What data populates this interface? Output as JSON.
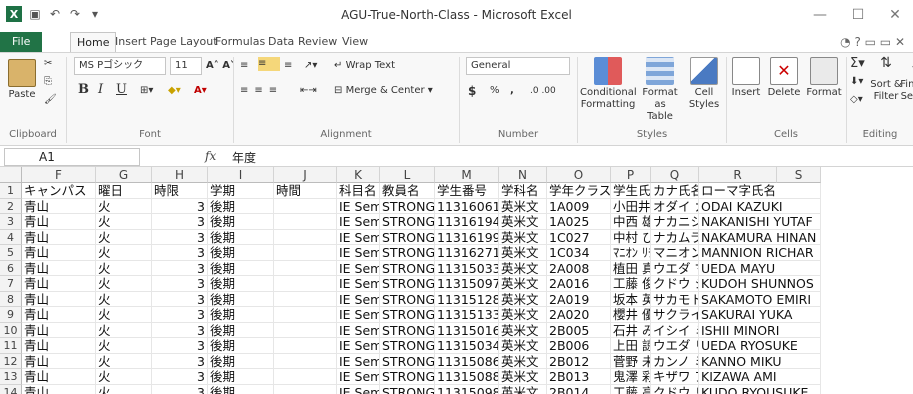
{
  "window": {
    "title": "AGU-True-North-Class - Microsoft Excel",
    "app_icon": "X",
    "minimize": "—",
    "maximize": "☐",
    "close": "✕"
  },
  "tabs": [
    "File",
    "Home",
    "Insert",
    "Page Layout",
    "Formulas",
    "Data",
    "Review",
    "View"
  ],
  "ribbon": {
    "paste": "Paste",
    "font_name": "MS Pゴシック",
    "font_size": "11",
    "bold": "B",
    "italic": "I",
    "underline": "U",
    "wrap_text": "Wrap Text",
    "merge_center": "Merge & Center",
    "number_format": "General",
    "currency": "$",
    "percent": "%",
    "comma": ",",
    "inc_dec": ".0 .00",
    "conditional_formatting": [
      "Conditional",
      "Formatting"
    ],
    "format_as_table": [
      "Format as",
      "Table"
    ],
    "cell_styles": [
      "Cell",
      "Styles"
    ],
    "insert": "Insert",
    "delete": "Delete",
    "format": "Format",
    "sort_filter": [
      "Sort &",
      "Filter"
    ],
    "find_select": [
      "Find &",
      "Select"
    ],
    "groups": [
      "Clipboard",
      "Font",
      "Alignment",
      "Number",
      "Styles",
      "Cells",
      "Editing"
    ]
  },
  "formula_bar": {
    "name_box": "A1",
    "fx": "fx",
    "content": "年度"
  },
  "columns": [
    "F",
    "G",
    "H",
    "I",
    "J",
    "K",
    "L",
    "M",
    "N",
    "O",
    "P",
    "Q",
    "R",
    "S"
  ],
  "rows": [
    {
      "n": "1",
      "F": "キャンパス",
      "G": "曜日",
      "H": "時限",
      "I": "学期",
      "J": "時間",
      "K": "科目名",
      "L": "教員名",
      "M": "学生番号",
      "N": "学科名",
      "O": "学年クラス",
      "P": "学生氏名",
      "Q": "カナ氏名",
      "R": "ローマ字氏名"
    },
    {
      "n": "2",
      "F": "青山",
      "G": "火",
      "H": "3",
      "I": "後期",
      "K": "IE  Semir",
      "L": "STRONG",
      "M": "11316061",
      "N": "英米文",
      "O": "1A009",
      "P": "小田井  和",
      "Q": "オダイ  カ",
      "R": "ODAI KAZUKI"
    },
    {
      "n": "3",
      "F": "青山",
      "G": "火",
      "H": "3",
      "I": "後期",
      "K": "IE  Semir",
      "L": "STRONG",
      "M": "11316194",
      "N": "英米文",
      "O": "1A025",
      "P": "中西  雄太",
      "Q": "ナカニシ  ユ",
      "R": "NAKANISHI YUTAF"
    },
    {
      "n": "4",
      "F": "青山",
      "G": "火",
      "H": "3",
      "I": "後期",
      "K": "IE  Semir",
      "L": "STRONG",
      "M": "11316199",
      "N": "英米文",
      "O": "1C027",
      "P": "中村  ひな",
      "Q": "ナカムラ  ヒ",
      "R": "NAKAMURA HINAN"
    },
    {
      "n": "5",
      "F": "青山",
      "G": "火",
      "H": "3",
      "I": "後期",
      "K": "IE  Semir",
      "L": "STRONG",
      "M": "11316271",
      "N": "英米文",
      "O": "1C034",
      "P": "ﾏﾆｵﾝ ﾘﾁｬ",
      "Q": "マニオン  リ",
      "R": "MANNION RICHAR"
    },
    {
      "n": "6",
      "F": "青山",
      "G": "火",
      "H": "3",
      "I": "後期",
      "K": "IE  Semir",
      "L": "STRONG",
      "M": "11315033",
      "N": "英米文",
      "O": "2A008",
      "P": "植田  真由",
      "Q": "ウエダ  マ",
      "R": "UEDA MAYU"
    },
    {
      "n": "7",
      "F": "青山",
      "G": "火",
      "H": "3",
      "I": "後期",
      "K": "IE  Semir",
      "L": "STRONG",
      "M": "11315097",
      "N": "英米文",
      "O": "2A016",
      "P": "工藤  俊之",
      "Q": "クドウ  シュ",
      "R": "KUDOH SHUNNOS"
    },
    {
      "n": "8",
      "F": "青山",
      "G": "火",
      "H": "3",
      "I": "後期",
      "K": "IE  Semir",
      "L": "STRONG",
      "M": "11315128",
      "N": "英米文",
      "O": "2A019",
      "P": "坂本  英実",
      "Q": "サカモト  エ",
      "R": "SAKAMOTO EMIRI"
    },
    {
      "n": "9",
      "F": "青山",
      "G": "火",
      "H": "3",
      "I": "後期",
      "K": "IE  Semir",
      "L": "STRONG",
      "M": "11315133",
      "N": "英米文",
      "O": "2A020",
      "P": "櫻井  優花",
      "Q": "サクライ  ユ",
      "R": "SAKURAI YUKA"
    },
    {
      "n": "10",
      "F": "青山",
      "G": "火",
      "H": "3",
      "I": "後期",
      "K": "IE  Semir",
      "L": "STRONG",
      "M": "11315016",
      "N": "英米文",
      "O": "2B005",
      "P": "石井  みの",
      "Q": "イシイ  ミノ",
      "R": "ISHII MINORI"
    },
    {
      "n": "11",
      "F": "青山",
      "G": "火",
      "H": "3",
      "I": "後期",
      "K": "IE  Semir",
      "L": "STRONG",
      "M": "11315034",
      "N": "英米文",
      "O": "2B006",
      "P": "上田  諒佑",
      "Q": "ウエダ  リョ",
      "R": "UEDA RYOSUKE"
    },
    {
      "n": "12",
      "F": "青山",
      "G": "火",
      "H": "3",
      "I": "後期",
      "K": "IE  Semir",
      "L": "STRONG",
      "M": "11315086",
      "N": "英米文",
      "O": "2B012",
      "P": "菅野  未来",
      "Q": "カンノ  ミク",
      "R": "KANNO MIKU"
    },
    {
      "n": "13",
      "F": "青山",
      "G": "火",
      "H": "3",
      "I": "後期",
      "K": "IE  Semir",
      "L": "STRONG",
      "M": "11315088",
      "N": "英米文",
      "O": "2B013",
      "P": "鬼澤  彩美",
      "Q": "キザワ  ア",
      "R": "KIZAWA AMI"
    },
    {
      "n": "14",
      "F": "青山",
      "G": "火",
      "H": "3",
      "I": "後期",
      "K": "IE  Semir",
      "L": "STRONG",
      "M": "11315098",
      "N": "英米文",
      "O": "2B014",
      "P": "工藤  亮佑",
      "Q": "クドウ  リョ",
      "R": "KUDO RYOUSUKE"
    }
  ]
}
